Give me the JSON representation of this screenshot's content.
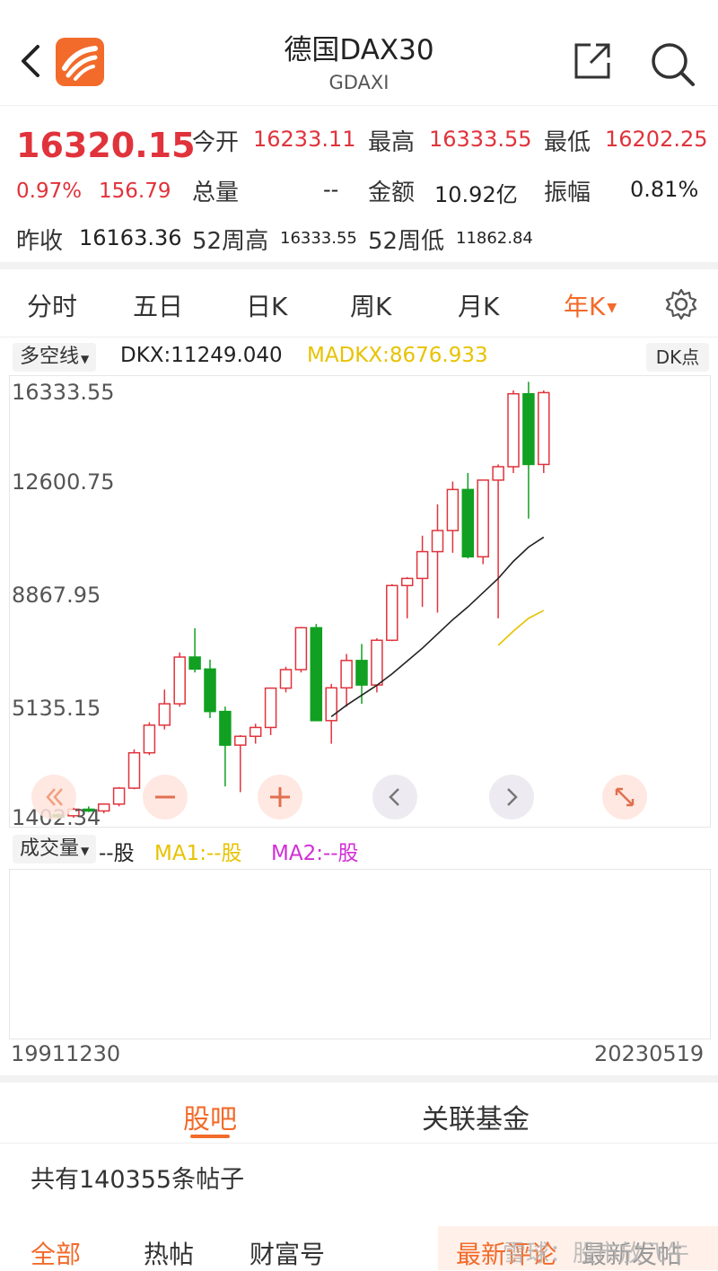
{
  "header": {
    "title": "德国DAX30",
    "subtitle": "GDAXI"
  },
  "quote": {
    "price": "16320.15",
    "change_pct": "0.97%",
    "change_abs": "156.79",
    "open_label": "今开",
    "open": "16233.11",
    "high_label": "最高",
    "high": "16333.55",
    "low_label": "最低",
    "low": "16202.25",
    "volume_label": "总量",
    "volume": "--",
    "amount_label": "金额",
    "amount": "10.92亿",
    "amplitude_label": "振幅",
    "amplitude": "0.81%",
    "prev_close_label": "昨收",
    "prev_close": "16163.36",
    "w52_high_label": "52周高",
    "w52_high": "16333.55",
    "w52_low_label": "52周低",
    "w52_low": "11862.84"
  },
  "period_tabs": [
    "分时",
    "五日",
    "日K",
    "周K",
    "月K",
    "年K"
  ],
  "active_period": "年K",
  "indicator": {
    "dropdown": "多空线",
    "dkx": "DKX:11249.040",
    "madkx": "MADKX:8676.933",
    "dk_button": "DK点"
  },
  "chart_data": {
    "type": "candlestick",
    "y_axis_labels": [
      "16333.55",
      "12600.75",
      "8867.95",
      "5135.15",
      "1402.34"
    ],
    "ylim": [
      1402.34,
      16333.55
    ],
    "up_color": "#e0333b",
    "down_color": "#11a021",
    "dkx_color": "#222222",
    "madkx_color": "#e8c200",
    "candles": [
      {
        "o": 1500,
        "h": 1560,
        "l": 1380,
        "c": 1470
      },
      {
        "o": 1470,
        "h": 1760,
        "l": 1400,
        "c": 1700
      },
      {
        "o": 1700,
        "h": 1800,
        "l": 1600,
        "c": 1640
      },
      {
        "o": 1640,
        "h": 1900,
        "l": 1560,
        "c": 1880
      },
      {
        "o": 1880,
        "h": 2480,
        "l": 1800,
        "c": 2440
      },
      {
        "o": 2440,
        "h": 3800,
        "l": 2400,
        "c": 3680
      },
      {
        "o": 3680,
        "h": 4750,
        "l": 3600,
        "c": 4650
      },
      {
        "o": 4650,
        "h": 5900,
        "l": 4500,
        "c": 5400
      },
      {
        "o": 5400,
        "h": 7200,
        "l": 5300,
        "c": 7040
      },
      {
        "o": 7040,
        "h": 8050,
        "l": 6500,
        "c": 6620
      },
      {
        "o": 6620,
        "h": 6950,
        "l": 4900,
        "c": 5130
      },
      {
        "o": 5130,
        "h": 5300,
        "l": 2500,
        "c": 3950
      },
      {
        "o": 3950,
        "h": 4300,
        "l": 2300,
        "c": 4260
      },
      {
        "o": 4260,
        "h": 4700,
        "l": 4000,
        "c": 4570
      },
      {
        "o": 4570,
        "h": 5800,
        "l": 4300,
        "c": 5950
      },
      {
        "o": 5950,
        "h": 6700,
        "l": 5800,
        "c": 6600
      },
      {
        "o": 6600,
        "h": 8100,
        "l": 6500,
        "c": 8070
      },
      {
        "o": 8070,
        "h": 8200,
        "l": 4800,
        "c": 4810
      },
      {
        "o": 4810,
        "h": 6100,
        "l": 4000,
        "c": 5960
      },
      {
        "o": 5960,
        "h": 7150,
        "l": 5300,
        "c": 6920
      },
      {
        "o": 6920,
        "h": 7500,
        "l": 5400,
        "c": 6060
      },
      {
        "o": 6060,
        "h": 7700,
        "l": 5800,
        "c": 7630
      },
      {
        "o": 7630,
        "h": 9600,
        "l": 7600,
        "c": 9550
      },
      {
        "o": 9550,
        "h": 9850,
        "l": 8400,
        "c": 9800
      },
      {
        "o": 9800,
        "h": 11300,
        "l": 8800,
        "c": 10740
      },
      {
        "o": 10740,
        "h": 12400,
        "l": 8600,
        "c": 11480
      },
      {
        "o": 11480,
        "h": 13200,
        "l": 10700,
        "c": 12920
      },
      {
        "o": 12920,
        "h": 13500,
        "l": 10500,
        "c": 10560
      },
      {
        "o": 10560,
        "h": 13250,
        "l": 10300,
        "c": 13250
      },
      {
        "o": 13250,
        "h": 13800,
        "l": 8400,
        "c": 13720
      },
      {
        "o": 13720,
        "h": 16400,
        "l": 13500,
        "c": 16280
      },
      {
        "o": 16280,
        "h": 16700,
        "l": 11900,
        "c": 13800
      },
      {
        "o": 13800,
        "h": 16400,
        "l": 13500,
        "c": 16320
      }
    ],
    "dkx": [
      null,
      null,
      null,
      null,
      null,
      null,
      null,
      null,
      null,
      null,
      null,
      null,
      null,
      null,
      null,
      null,
      null,
      null,
      4950,
      5350,
      5700,
      6050,
      6450,
      6900,
      7350,
      7850,
      8350,
      8800,
      9300,
      9800,
      10400,
      10900,
      11249
    ],
    "madkx": [
      null,
      null,
      null,
      null,
      null,
      null,
      null,
      null,
      null,
      null,
      null,
      null,
      null,
      null,
      null,
      null,
      null,
      null,
      null,
      null,
      null,
      null,
      null,
      null,
      null,
      null,
      null,
      null,
      null,
      7450,
      7950,
      8400,
      8677
    ]
  },
  "chart_controls": [
    "zoom-out",
    "zoom-in",
    "prev",
    "next",
    "fullscreen"
  ],
  "volume": {
    "dropdown": "成交量",
    "vol": "--股",
    "ma1": "MA1:--股",
    "ma2": "MA2:--股"
  },
  "dates": {
    "start": "19911230",
    "end": "20230519"
  },
  "bottom_tabs": [
    "股吧",
    "关联基金"
  ],
  "posts_count": "共有140355条帖子",
  "filter_tabs": [
    "全部",
    "热帖",
    "财富号",
    "最新评论",
    "最新发帖"
  ],
  "watermark": "雪球：股市放飞牛"
}
